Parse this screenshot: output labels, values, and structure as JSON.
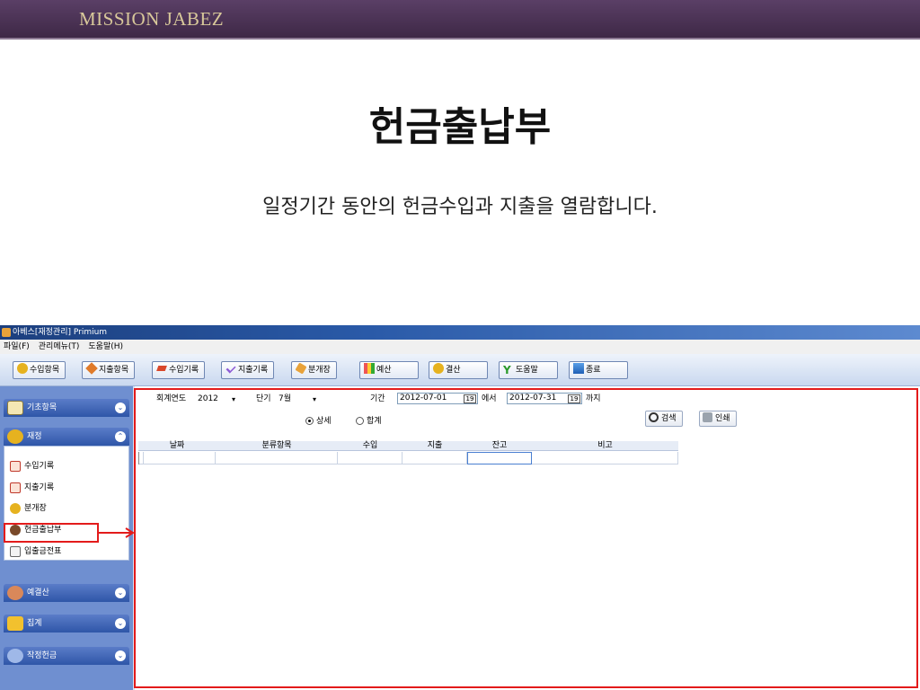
{
  "slide": {
    "brand": "MISSION JABEZ",
    "title": "헌금출납부",
    "subtitle": "일정기간 동안의 헌금수입과 지출을 열람합니다."
  },
  "app": {
    "window_title": "아베스[재정관리] Primium",
    "menu": [
      "파일(F)",
      "관리메뉴(T)",
      "도움말(H)"
    ],
    "toolbar": [
      {
        "label": "수입항목",
        "icon": "coins-icon"
      },
      {
        "label": "지출항목",
        "icon": "tag-icon"
      },
      {
        "label": "수입기록",
        "icon": "pencil-icon"
      },
      {
        "label": "지출기록",
        "icon": "check-pencil-icon"
      },
      {
        "label": "분개장",
        "icon": "ledger-icon"
      },
      {
        "label": "예산",
        "icon": "bar-chart-icon"
      },
      {
        "label": "결산",
        "icon": "coins-icon"
      },
      {
        "label": "도움말",
        "icon": "help-icon"
      },
      {
        "label": "종료",
        "icon": "exit-icon"
      }
    ],
    "sidebar": {
      "groups": [
        {
          "label": "기초항목",
          "icon": "notepad-icon",
          "state": "collapsed"
        },
        {
          "label": "재정",
          "icon": "coins-icon",
          "state": "expanded"
        },
        {
          "label": "예결산",
          "icon": "calculator-icon",
          "state": "collapsed"
        },
        {
          "label": "집계",
          "icon": "folder-icon",
          "state": "collapsed"
        },
        {
          "label": "작정헌금",
          "icon": "wand-icon",
          "state": "collapsed"
        }
      ],
      "items": [
        {
          "label": "수입기록",
          "icon": "pencil-icon"
        },
        {
          "label": "지출기록",
          "icon": "pencil-icon"
        },
        {
          "label": "분개장",
          "icon": "coins-icon"
        },
        {
          "label": "헌금출납부",
          "icon": "moneybag-icon",
          "highlighted": true
        },
        {
          "label": "입출금전표",
          "icon": "document-icon"
        }
      ]
    },
    "filters": {
      "fiscal_year_label": "회계연도",
      "fiscal_year_value": "2012",
      "period_label": "단기",
      "period_value": "7월",
      "range_label": "기간",
      "start_date": "2012-07-01",
      "from_suffix": "에서",
      "end_date": "2012-07-31",
      "to_suffix": "까지",
      "calendar_glyph": "19",
      "detail_label": "상세",
      "summary_label": "합계",
      "selected_mode": "상세"
    },
    "actions": {
      "search_label": "검색",
      "print_label": "인쇄"
    },
    "table": {
      "columns": [
        "날짜",
        "분류항목",
        "수입",
        "지출",
        "잔고",
        "비고"
      ],
      "rows": []
    }
  },
  "colors": {
    "header_bg": "#4a3254",
    "brand_text": "#d8c89a",
    "highlight": "#e31b1b",
    "sidebar_bg": "#6f8fd0"
  }
}
